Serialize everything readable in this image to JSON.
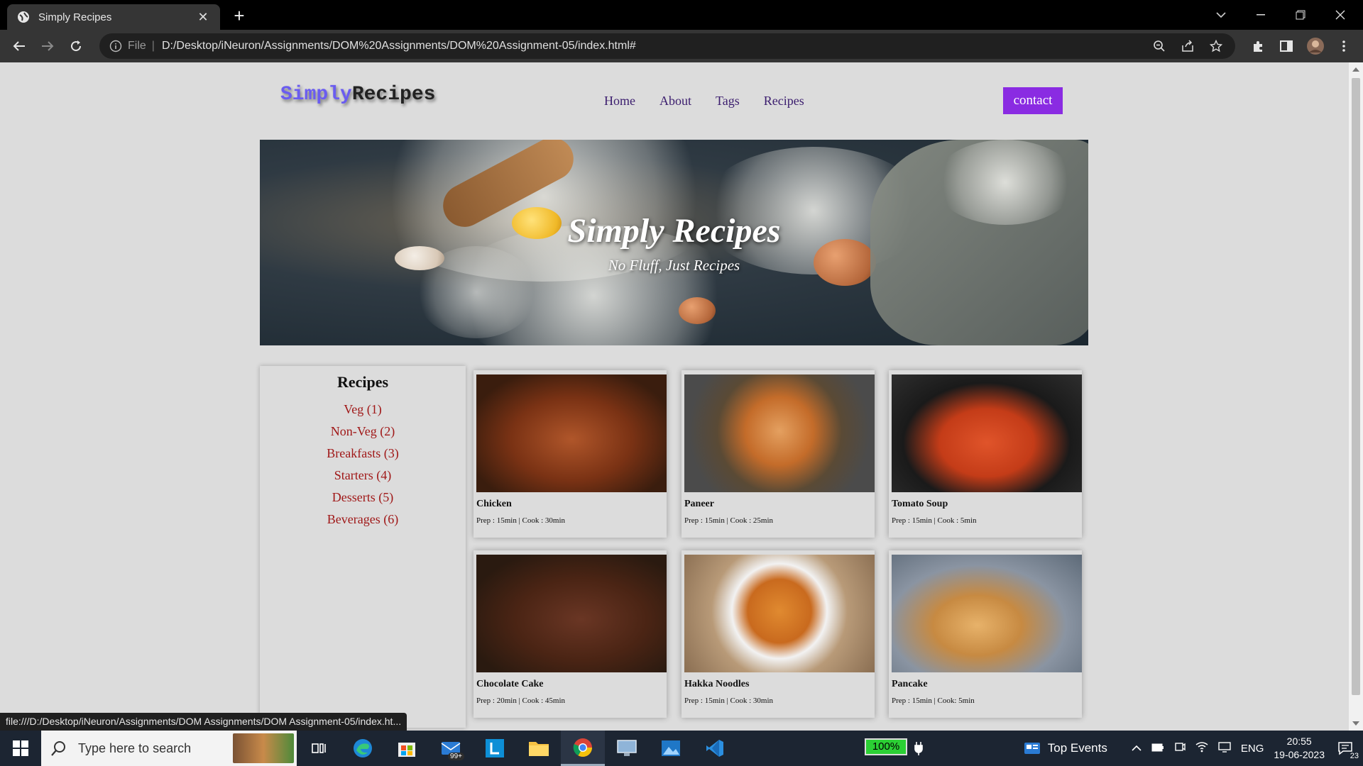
{
  "browser": {
    "tab_title": "Simply Recipes",
    "url_scheme": "File",
    "url": "D:/Desktop/iNeuron/Assignments/DOM%20Assignments/DOM%20Assignment-05/index.html#",
    "status_url": "file:///D:/Desktop/iNeuron/Assignments/DOM Assignments/DOM Assignment-05/index.ht..."
  },
  "site": {
    "logo_part1": "Simply",
    "logo_part2": "Recipes",
    "nav": [
      "Home",
      "About",
      "Tags",
      "Recipes"
    ],
    "contact_label": "contact",
    "hero_title": "Simply Recipes",
    "hero_subtitle": "No Fluff, Just Recipes"
  },
  "sidebar": {
    "heading": "Recipes",
    "items": [
      "Veg (1)",
      "Non-Veg (2)",
      "Breakfasts (3)",
      "Starters (4)",
      "Desserts (5)",
      "Beverages (6)"
    ]
  },
  "recipes": [
    {
      "name": "Chicken",
      "meta": "Prep : 15min | Cook : 30min",
      "image": "chicken"
    },
    {
      "name": "Paneer",
      "meta": "Prep : 15min | Cook : 25min",
      "image": "paneer"
    },
    {
      "name": "Tomato Soup",
      "meta": "Prep : 15min | Cook : 5min",
      "image": "soup"
    },
    {
      "name": "Chocolate Cake",
      "meta": "Prep : 20min | Cook : 45min",
      "image": "cake"
    },
    {
      "name": "Hakka Noodles",
      "meta": "Prep : 15min | Cook : 30min",
      "image": "noodles"
    },
    {
      "name": "Pancake",
      "meta": "Prep : 15min | Cook: 5min",
      "image": "pancake"
    }
  ],
  "taskbar": {
    "search_placeholder": "Type here to search",
    "mail_badge": "99+",
    "battery": "100%",
    "top_events": "Top Events",
    "language": "ENG",
    "time": "20:55",
    "date": "19-06-2023",
    "notification_count": "23"
  },
  "colors": {
    "accent_purple": "#8a2be2",
    "logo_blue": "#6a5cf0",
    "link_red": "#a01818",
    "page_bg": "#dcdcdc"
  }
}
